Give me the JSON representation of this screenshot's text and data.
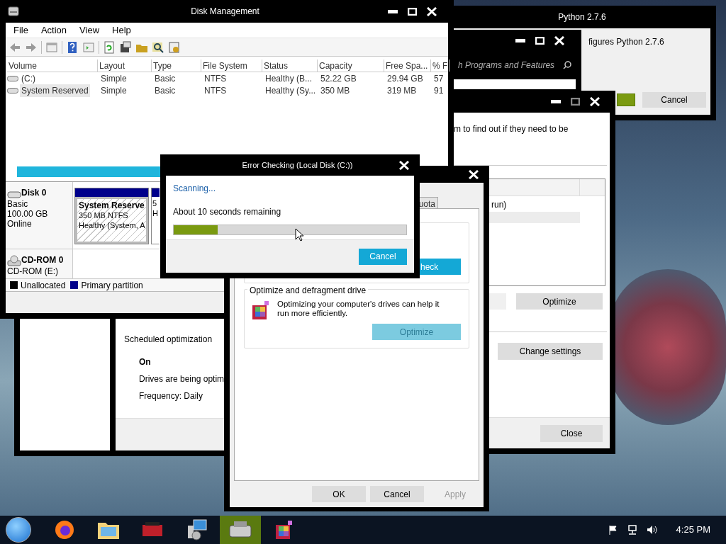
{
  "python_window": {
    "title": "Python 2.7.6",
    "text": "figures Python 2.7.6",
    "cancel_button": "Cancel"
  },
  "programs_window": {
    "placeholder": "h Programs and Features"
  },
  "optimize_window": {
    "description": "m to find out if they need to be",
    "list_row": {
      "text": "run)",
      "selected": false
    },
    "selected_row": {
      "selected": true
    },
    "optimize_button": "Optimize",
    "change_settings_button": "Change settings",
    "close_button": "Close"
  },
  "scheduled_window": {
    "heading": "Scheduled optimization",
    "status": "On",
    "lines": [
      "Drives are being optim",
      "Frequency: Daily"
    ]
  },
  "disk_management": {
    "title": "Disk Management",
    "menu": [
      "File",
      "Action",
      "View",
      "Help"
    ],
    "table": {
      "columns": [
        "Volume",
        "Layout",
        "Type",
        "File System",
        "Status",
        "Capacity",
        "Free Spa...",
        "% F"
      ],
      "rows": [
        {
          "cells": [
            "(C:)",
            "Simple",
            "Basic",
            "NTFS",
            "Healthy (B...",
            "52.22 GB",
            "29.94 GB",
            "57"
          ],
          "selected": false
        },
        {
          "cells": [
            "System Reserved",
            "Simple",
            "Basic",
            "NTFS",
            "Healthy (Sy...",
            "350 MB",
            "319 MB",
            "91"
          ],
          "selected": true
        }
      ]
    },
    "disks": [
      {
        "kind": "disk",
        "name": "Disk 0",
        "lines": [
          "Basic",
          "100.00 GB",
          "Online"
        ],
        "partitions": [
          {
            "name": "System Reserve",
            "lines": [
              "350 MB NTFS",
              "Healthy (System, A"
            ],
            "selected": true
          },
          {
            "lines": [
              "5",
              "H"
            ],
            "selected": false
          }
        ]
      },
      {
        "kind": "cdrom",
        "name": "CD-ROM 0",
        "lines": [
          "CD-ROM (E:)"
        ]
      }
    ],
    "legend": [
      {
        "label": "Unallocated",
        "color": "#000000"
      },
      {
        "label": "Primary partition",
        "color": "#00008b"
      }
    ]
  },
  "properties_window": {
    "tab": {
      "label": "uota",
      "selected": false
    },
    "error_check_button": "heck",
    "optimize_group": {
      "title": "Optimize and defragment drive",
      "text": "Optimizing your computer's drives can help it run more efficiently.",
      "button": {
        "label": "Optimize",
        "disabled": true
      }
    },
    "buttons": [
      {
        "label": "OK",
        "disabled": false
      },
      {
        "label": "Cancel",
        "disabled": false
      },
      {
        "label": "Apply",
        "disabled": true
      }
    ]
  },
  "error_dialog": {
    "title": "Error Checking (Local Disk (C:))",
    "status": "Scanning...",
    "remaining": "About 10 seconds remaining",
    "progress": {
      "level": 0.19
    },
    "button": "Cancel"
  },
  "taskbar": {
    "apps": [
      {
        "kind": "browser",
        "selected": false
      },
      {
        "kind": "folder",
        "selected": false
      },
      {
        "kind": "toolbox",
        "selected": false
      },
      {
        "kind": "installer",
        "selected": false
      },
      {
        "kind": "cleanup",
        "selected": true
      },
      {
        "kind": "defrag",
        "selected": false
      }
    ],
    "clock": "4:25 PM"
  }
}
